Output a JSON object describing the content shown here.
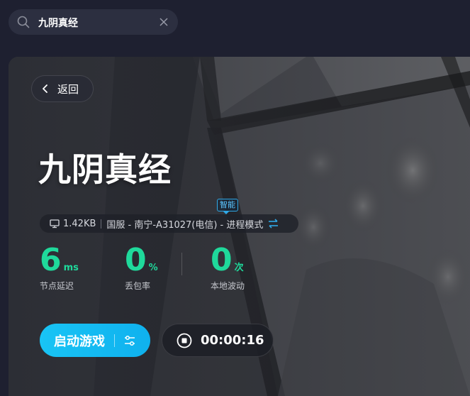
{
  "search": {
    "value": "九阴真经",
    "icon": "search-icon",
    "clear_icon": "close-icon"
  },
  "game": {
    "back_label": "返回",
    "title": "九阴真经",
    "smart_badge": "智能",
    "info": {
      "speed": "1.42KB",
      "route": "国服 - 南宁-A31027(电信) - 进程模式"
    },
    "stats": [
      {
        "value": "6",
        "unit": "ms",
        "label": "节点延迟"
      },
      {
        "value": "0",
        "unit": "%",
        "label": "丢包率"
      },
      {
        "value": "0",
        "unit": "次",
        "label": "本地波动"
      }
    ],
    "launch_label": "启动游戏",
    "timer": "00:00:16"
  },
  "colors": {
    "accent_green": "#1fd99b",
    "accent_blue": "#19c4f5",
    "badge_blue": "#2fa8e6",
    "background": "#1e2030"
  }
}
